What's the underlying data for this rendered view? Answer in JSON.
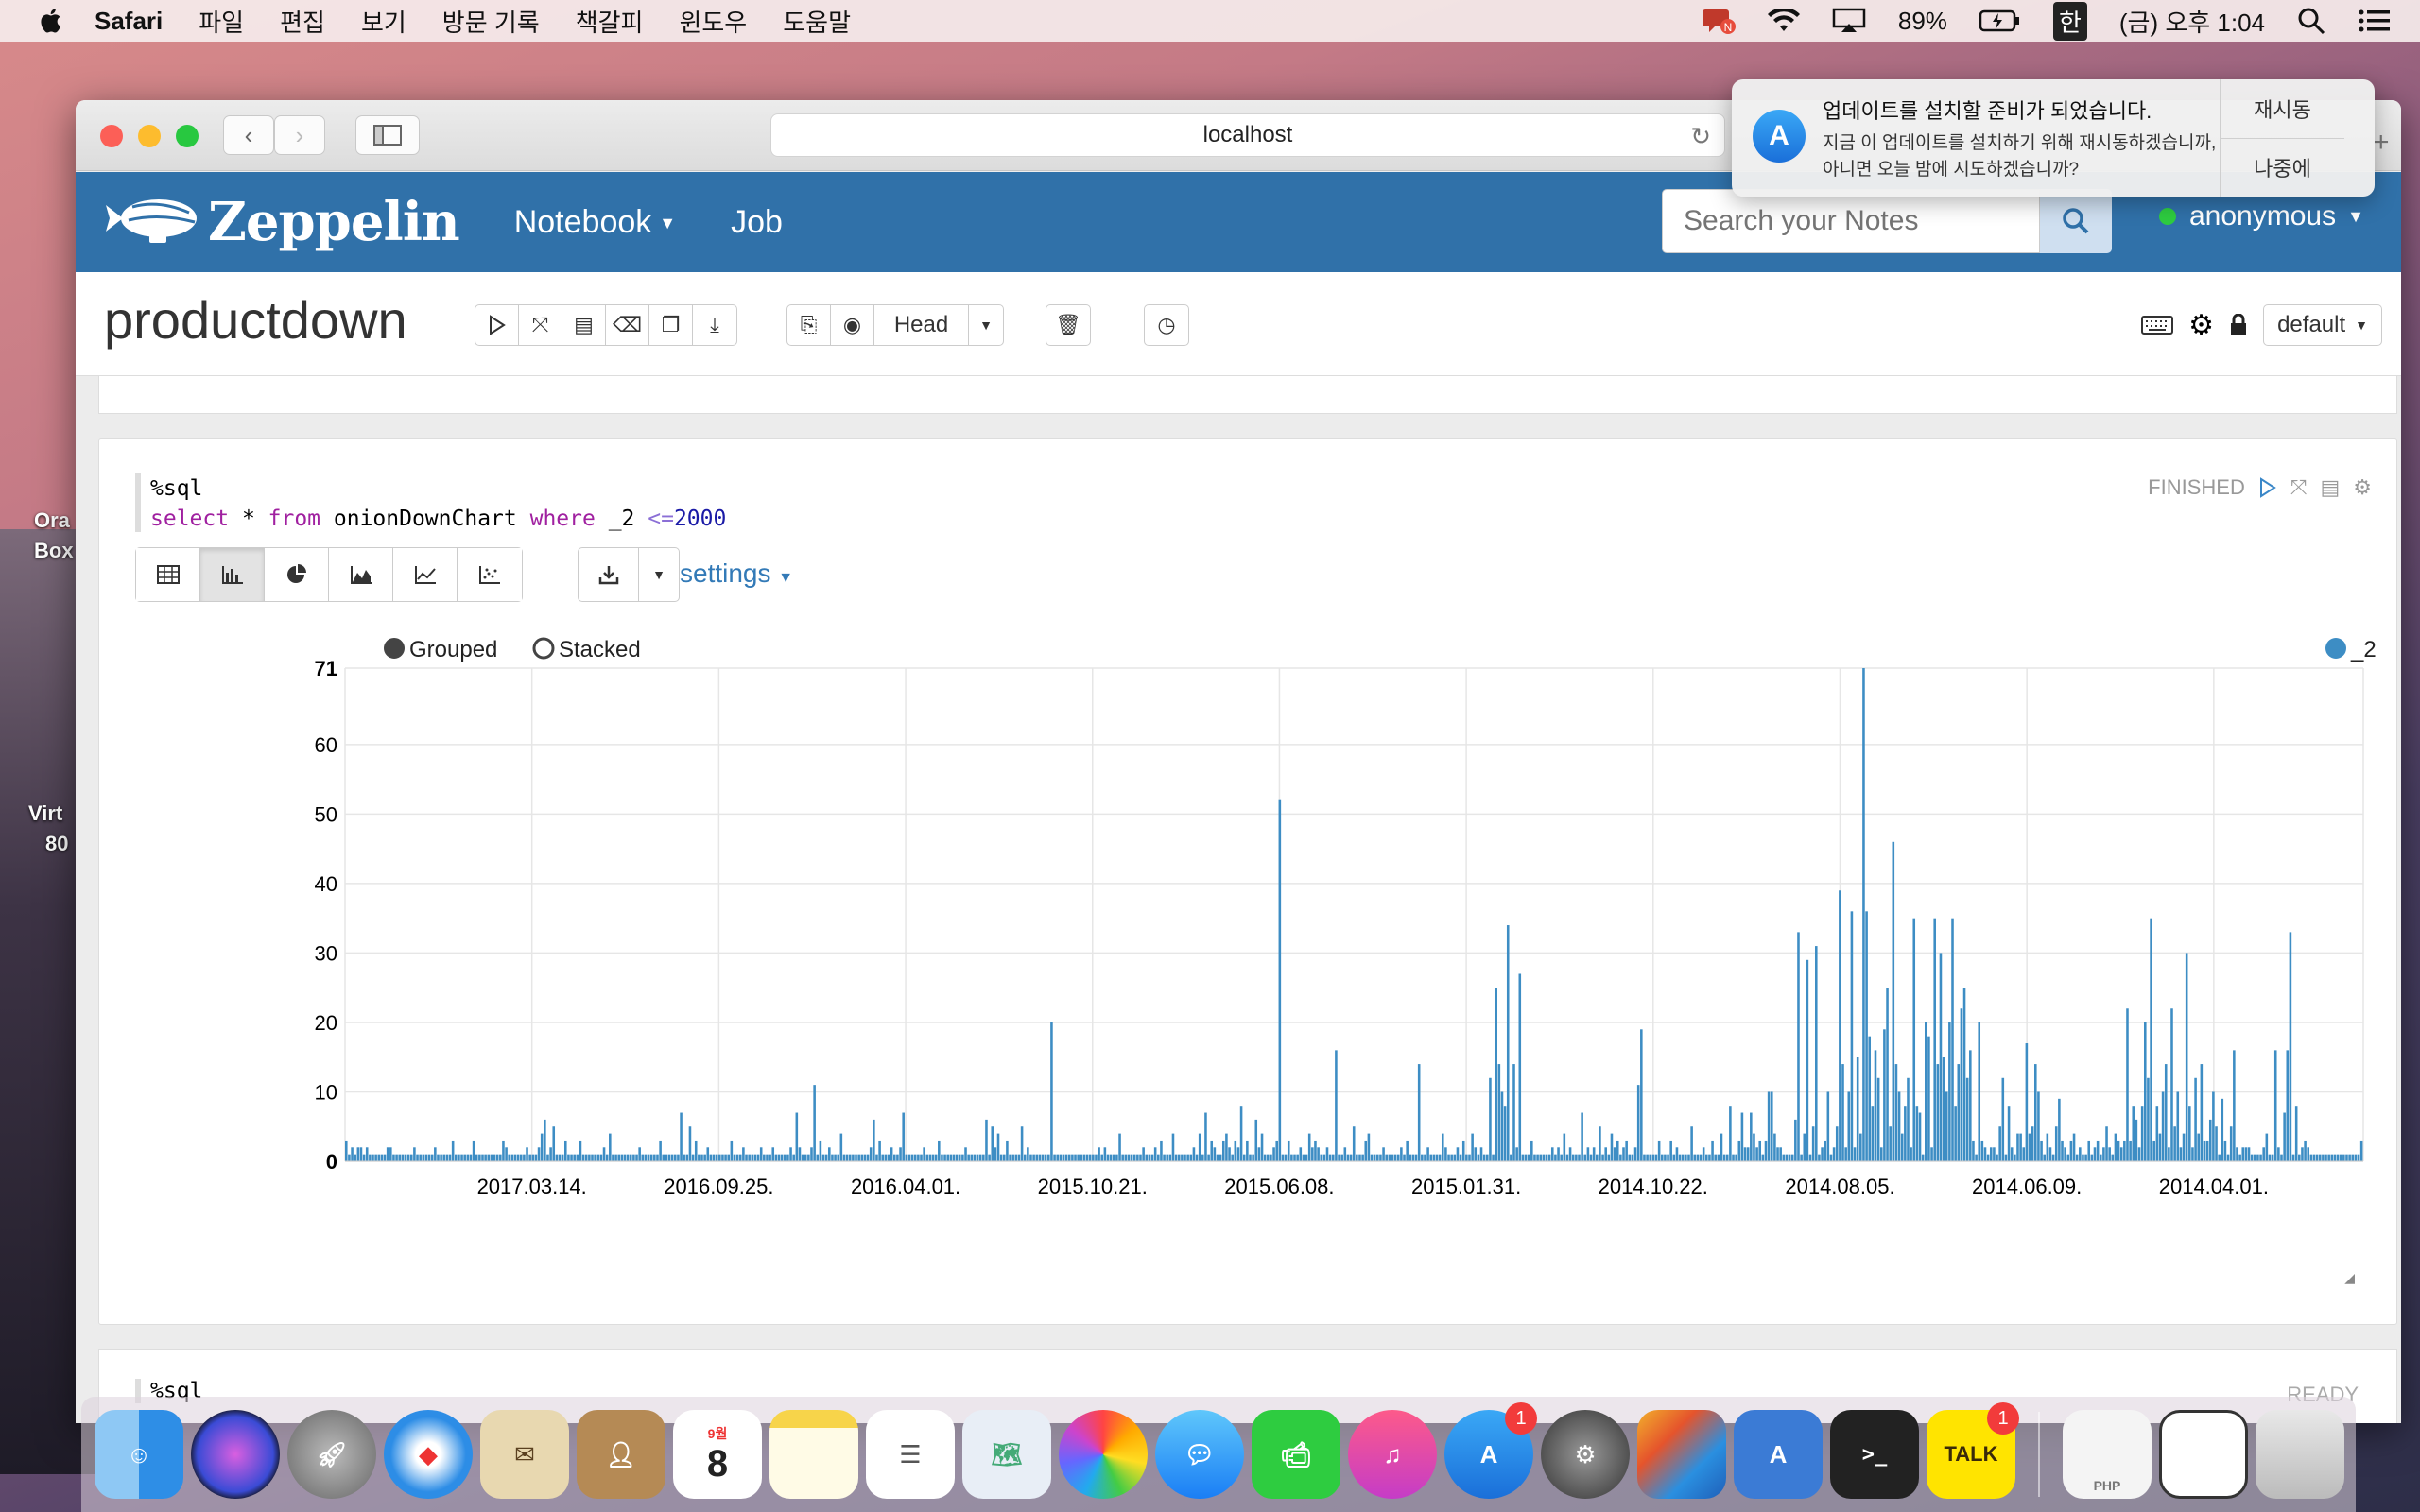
{
  "menubar": {
    "app": "Safari",
    "items": [
      "파일",
      "편집",
      "보기",
      "방문 기록",
      "책갈피",
      "윈도우",
      "도움말"
    ],
    "battery": "89%",
    "input": "한",
    "clock": "(금) 오후 1:04"
  },
  "desktop": {
    "labels": [
      "Ora",
      "Box",
      "Virt",
      "80"
    ]
  },
  "browser": {
    "url": "localhost"
  },
  "notification": {
    "title": "업데이트를 설치할 준비가 되었습니다.",
    "body": "지금 이 업데이트를 설치하기 위해 재시동하겠습니까, 아니면 오늘 밤에 시도하겠습니까?",
    "action_restart": "재시동",
    "action_later": "나중에"
  },
  "zeppelin": {
    "brand": "Zeppelin",
    "nav_notebook": "Notebook",
    "nav_job": "Job",
    "search_placeholder": "Search your Notes",
    "user": "anonymous"
  },
  "notebook": {
    "title": "productdown",
    "head_label": "Head",
    "interpreter_default": "default"
  },
  "paragraph": {
    "code_line1": "%sql",
    "code_select": "select",
    "code_star": " * ",
    "code_from": "from",
    "code_table": " onionDownChart ",
    "code_where": "where",
    "code_col": " _2 ",
    "code_op": "<=",
    "code_num": "2000",
    "status": "FINISHED",
    "settings_label": "settings"
  },
  "next_paragraph": {
    "code": "%sql",
    "status": "READY"
  },
  "chart_data": {
    "type": "bar",
    "legend_modes": [
      "Grouped",
      "Stacked"
    ],
    "selected_mode": "Grouped",
    "series_name": "_2",
    "series_color": "#3d8dc4",
    "ylim": [
      0,
      71
    ],
    "yticks": [
      0,
      10,
      20,
      30,
      40,
      50,
      60,
      71
    ],
    "xtick_labels": [
      "2017.03.14.",
      "2016.09.25.",
      "2016.04.01.",
      "2015.10.21.",
      "2015.06.08.",
      "2015.01.31.",
      "2014.10.22.",
      "2014.08.05.",
      "2014.06.09.",
      "2014.04.01."
    ],
    "values": [
      3,
      1,
      2,
      1,
      2,
      2,
      1,
      2,
      1,
      1,
      1,
      1,
      1,
      1,
      2,
      2,
      1,
      1,
      1,
      1,
      1,
      1,
      1,
      2,
      1,
      1,
      1,
      1,
      1,
      1,
      2,
      1,
      1,
      1,
      1,
      1,
      3,
      1,
      1,
      1,
      1,
      1,
      1,
      3,
      1,
      1,
      1,
      1,
      1,
      1,
      1,
      1,
      1,
      3,
      2,
      1,
      1,
      1,
      1,
      1,
      1,
      2,
      1,
      1,
      1,
      2,
      4,
      6,
      1,
      2,
      5,
      1,
      1,
      1,
      3,
      1,
      1,
      1,
      1,
      3,
      1,
      1,
      1,
      1,
      1,
      1,
      1,
      2,
      1,
      4,
      1,
      1,
      1,
      1,
      1,
      1,
      1,
      1,
      1,
      2,
      1,
      1,
      1,
      1,
      1,
      1,
      3,
      1,
      1,
      1,
      1,
      1,
      1,
      7,
      1,
      1,
      5,
      1,
      3,
      1,
      1,
      1,
      2,
      1,
      1,
      1,
      1,
      1,
      1,
      1,
      3,
      1,
      1,
      1,
      2,
      1,
      1,
      1,
      1,
      1,
      2,
      1,
      1,
      1,
      2,
      1,
      1,
      1,
      1,
      1,
      2,
      1,
      7,
      2,
      1,
      1,
      1,
      2,
      11,
      1,
      3,
      1,
      1,
      2,
      1,
      1,
      1,
      4,
      1,
      1,
      1,
      1,
      1,
      1,
      1,
      1,
      1,
      2,
      6,
      1,
      3,
      1,
      1,
      1,
      2,
      1,
      1,
      2,
      7,
      1,
      1,
      1,
      1,
      1,
      1,
      2,
      1,
      1,
      1,
      1,
      3,
      1,
      1,
      1,
      1,
      1,
      1,
      1,
      1,
      2,
      1,
      1,
      1,
      1,
      1,
      1,
      6,
      1,
      5,
      2,
      4,
      1,
      1,
      3,
      1,
      1,
      1,
      1,
      5,
      1,
      2,
      1,
      1,
      1,
      1,
      1,
      1,
      1,
      20,
      1,
      1,
      1,
      1,
      1,
      1,
      1,
      1,
      1,
      1,
      1,
      1,
      1,
      1,
      1,
      2,
      1,
      2,
      1,
      1,
      1,
      1,
      4,
      1,
      1,
      1,
      1,
      1,
      1,
      1,
      2,
      1,
      1,
      1,
      2,
      1,
      3,
      1,
      1,
      1,
      4,
      1,
      1,
      1,
      1,
      1,
      1,
      2,
      1,
      4,
      1,
      7,
      1,
      3,
      2,
      1,
      1,
      3,
      4,
      2,
      1,
      3,
      2,
      8,
      1,
      3,
      1,
      1,
      6,
      2,
      4,
      1,
      1,
      1,
      2,
      3,
      52,
      1,
      1,
      3,
      1,
      1,
      1,
      2,
      1,
      1,
      4,
      2,
      3,
      2,
      1,
      1,
      2,
      1,
      1,
      16,
      1,
      1,
      2,
      1,
      1,
      5,
      1,
      1,
      1,
      3,
      4,
      1,
      1,
      1,
      1,
      2,
      1,
      1,
      1,
      1,
      1,
      2,
      1,
      3,
      1,
      1,
      1,
      14,
      1,
      1,
      2,
      1,
      1,
      1,
      1,
      4,
      2,
      1,
      1,
      1,
      2,
      1,
      3,
      1,
      1,
      4,
      2,
      1,
      2,
      1,
      1,
      12,
      1,
      25,
      14,
      10,
      8,
      34,
      1,
      14,
      2,
      27,
      1,
      1,
      1,
      3,
      1,
      1,
      1,
      1,
      1,
      1,
      2,
      1,
      2,
      1,
      4,
      1,
      2,
      1,
      1,
      1,
      7,
      1,
      2,
      1,
      2,
      1,
      5,
      1,
      2,
      1,
      4,
      2,
      3,
      1,
      2,
      3,
      1,
      1,
      2,
      11,
      19,
      1,
      1,
      1,
      1,
      1,
      3,
      1,
      1,
      1,
      3,
      1,
      2,
      1,
      1,
      1,
      1,
      5,
      1,
      1,
      1,
      2,
      1,
      1,
      3,
      1,
      1,
      4,
      1,
      1,
      8,
      1,
      1,
      3,
      7,
      2,
      2,
      7,
      4,
      2,
      3,
      1,
      3,
      10,
      10,
      4,
      2,
      2,
      1,
      1,
      1,
      1,
      6,
      33,
      1,
      4,
      29,
      1,
      5,
      31,
      1,
      2,
      3,
      10,
      1,
      2,
      5,
      39,
      14,
      2,
      10,
      36,
      2,
      15,
      4,
      71,
      36,
      18,
      8,
      16,
      12,
      2,
      19,
      25,
      5,
      46,
      14,
      10,
      4,
      8,
      12,
      2,
      35,
      8,
      7,
      1,
      20,
      18,
      2,
      35,
      14,
      30,
      15,
      10,
      20,
      35,
      8,
      14,
      22,
      25,
      12,
      16,
      3,
      1,
      20,
      3,
      2,
      1,
      2,
      2,
      1,
      5,
      12,
      1,
      8,
      2,
      1,
      4,
      4,
      2,
      17,
      4,
      5,
      14,
      10,
      3,
      1,
      4,
      2,
      1,
      5,
      9,
      3,
      2,
      1,
      3,
      4,
      1,
      2,
      1,
      1,
      3,
      1,
      2,
      3,
      1,
      2,
      5,
      2,
      1,
      4,
      3,
      2,
      3,
      22,
      3,
      8,
      6,
      2,
      8,
      20,
      12,
      35,
      3,
      8,
      4,
      10,
      14,
      2,
      22,
      5,
      10,
      2,
      4,
      30,
      8,
      2,
      12,
      4,
      14,
      3,
      3,
      6,
      10,
      5,
      1,
      9,
      3,
      1,
      5,
      16,
      2,
      1,
      2,
      2,
      2,
      1,
      1,
      1,
      1,
      2,
      4,
      1,
      1,
      16,
      2,
      1,
      7,
      16,
      33,
      1,
      8,
      1,
      2,
      3,
      2,
      1,
      1,
      1,
      1,
      1,
      1,
      1,
      1,
      1,
      1,
      1,
      1,
      1,
      1,
      1,
      1,
      1,
      3
    ]
  },
  "dock": {
    "calendar_month": "9월",
    "calendar_day": "8",
    "appstore_badge": "1",
    "kakao_label": "TALK",
    "kakao_badge": "1",
    "php_label": "PHP"
  }
}
